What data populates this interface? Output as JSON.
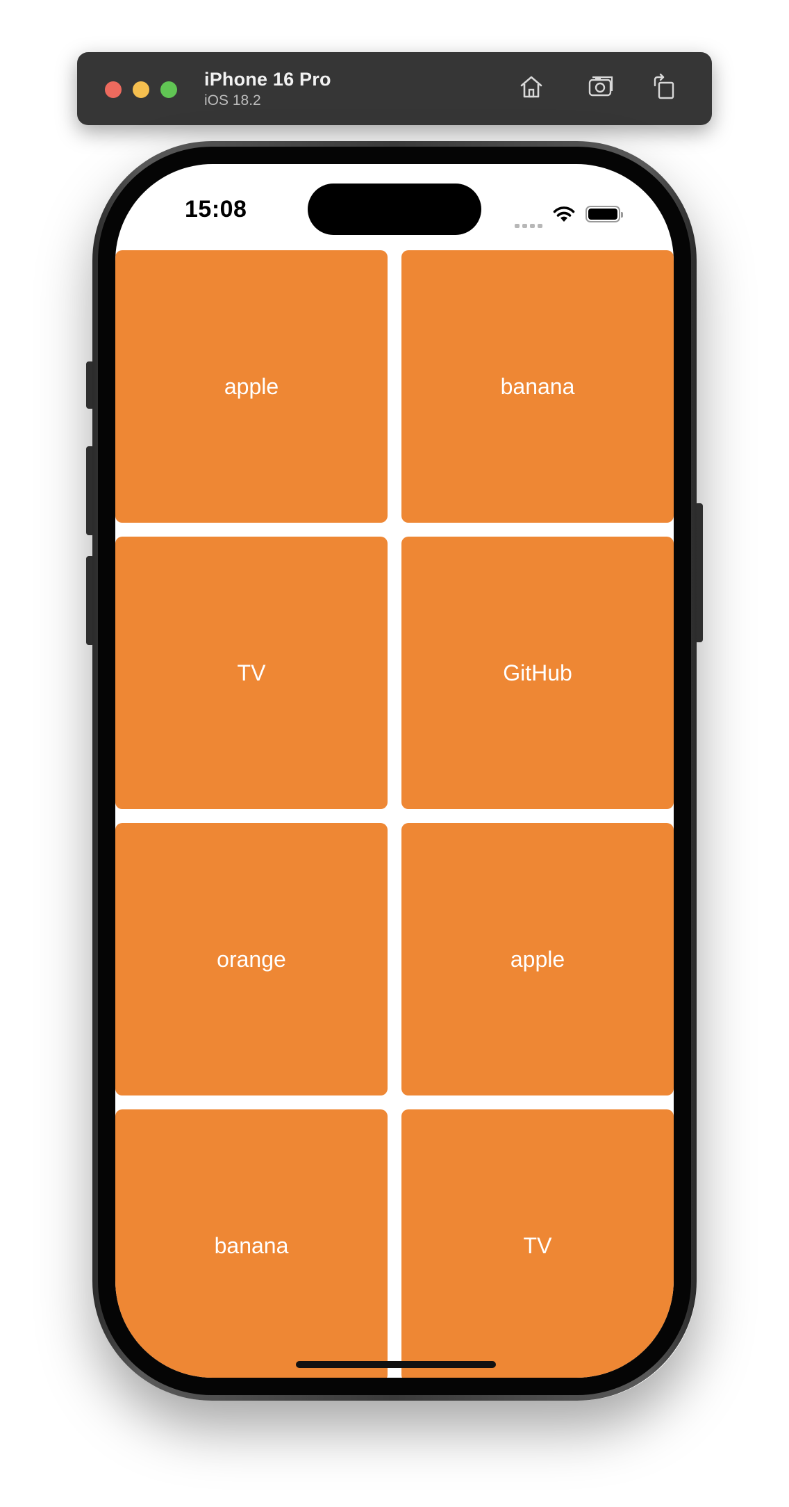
{
  "simulator": {
    "device_name": "iPhone 16 Pro",
    "os_version": "iOS 18.2",
    "buttons": [
      {
        "name": "home-button",
        "icon": "house-icon"
      },
      {
        "name": "screenshot-button",
        "icon": "camera-icon"
      },
      {
        "name": "rotate-button",
        "icon": "rotate-icon"
      }
    ]
  },
  "status_bar": {
    "time": "15:08",
    "icons": [
      "cellular-signal-icon",
      "wifi-icon",
      "battery-icon"
    ]
  },
  "grid": {
    "tile_color": "#EE8734",
    "text_color": "#FFFFFF",
    "items": [
      {
        "label": "apple"
      },
      {
        "label": "banana"
      },
      {
        "label": "TV"
      },
      {
        "label": "GitHub"
      },
      {
        "label": "orange"
      },
      {
        "label": "apple"
      },
      {
        "label": "banana"
      },
      {
        "label": "TV"
      }
    ]
  }
}
